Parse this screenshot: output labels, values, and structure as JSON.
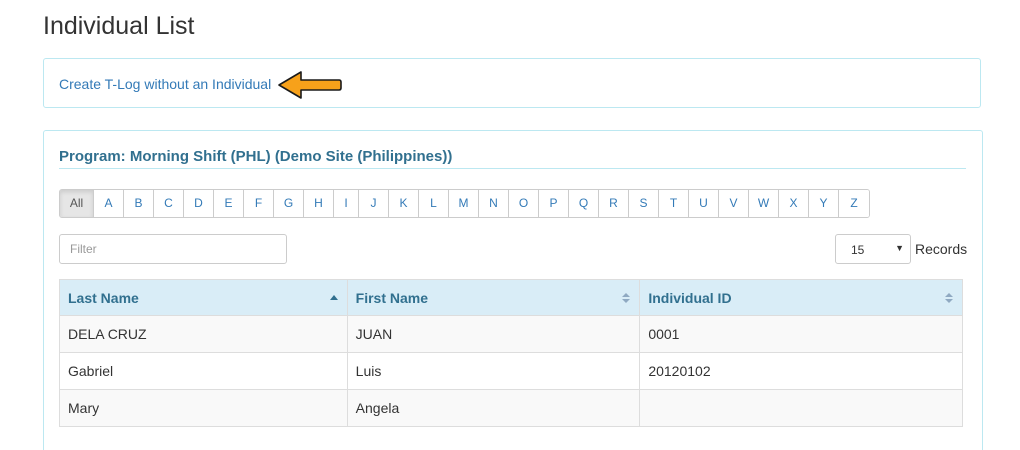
{
  "page": {
    "title": "Individual List"
  },
  "tlog": {
    "link_label": "Create T-Log without an Individual",
    "arrow_icon": "arrow-left-icon",
    "arrow_color": "#f7a11a"
  },
  "program": {
    "title": "Program: Morning Shift (PHL) (Demo Site (Philippines))"
  },
  "alphabet": {
    "items": [
      "All",
      "A",
      "B",
      "C",
      "D",
      "E",
      "F",
      "G",
      "H",
      "I",
      "J",
      "K",
      "L",
      "M",
      "N",
      "O",
      "P",
      "Q",
      "R",
      "S",
      "T",
      "U",
      "V",
      "W",
      "X",
      "Y",
      "Z"
    ],
    "active": "All"
  },
  "filter": {
    "placeholder": "Filter",
    "value": ""
  },
  "records": {
    "selected": "15",
    "label": "Records"
  },
  "table": {
    "columns": [
      {
        "label": "Last Name",
        "sort": "asc"
      },
      {
        "label": "First Name",
        "sort": "both"
      },
      {
        "label": "Individual ID",
        "sort": "both"
      }
    ],
    "rows": [
      [
        "DELA CRUZ",
        "JUAN",
        "0001"
      ],
      [
        "Gabriel",
        "Luis",
        "20120102"
      ],
      [
        "Mary",
        "Angela",
        ""
      ]
    ]
  },
  "colors": {
    "link": "#337ab7",
    "header_text": "#31708f",
    "header_bg": "#d9edf7",
    "panel_border": "#bce8f1"
  }
}
